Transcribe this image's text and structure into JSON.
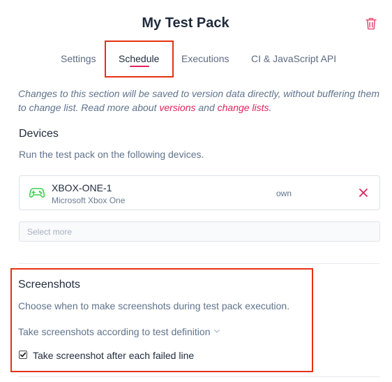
{
  "header": {
    "title": "My Test Pack",
    "delete_icon": "trash-icon"
  },
  "tabs": [
    {
      "label": "Settings",
      "active": false
    },
    {
      "label": "Schedule",
      "active": true
    },
    {
      "label": "Executions",
      "active": false
    },
    {
      "label": "CI & JavaScript API",
      "active": false
    }
  ],
  "notice": {
    "text_1": "Changes to this section will be saved to version data directly, without buffering them to change list. Read more about ",
    "link_versions": "versions",
    "text_2": " and ",
    "link_change_lists": "change lists",
    "text_3": "."
  },
  "devices": {
    "heading": "Devices",
    "description": "Run the test pack on the following devices.",
    "items": [
      {
        "name": "XBOX-ONE-1",
        "model": "Microsoft Xbox One",
        "owner": "own",
        "icon": "gamepad-icon"
      }
    ],
    "select_placeholder": "Select more"
  },
  "screenshots": {
    "heading": "Screenshots",
    "description": "Choose when to make screenshots during test pack execution.",
    "mode_selected": "Take screenshots according to test definition",
    "failed_line_label": "Take screenshot after each failed line",
    "failed_line_checked": true
  },
  "colors": {
    "accent": "#e0245e",
    "highlight": "#e53212",
    "device_icon": "#3ccf4e"
  }
}
